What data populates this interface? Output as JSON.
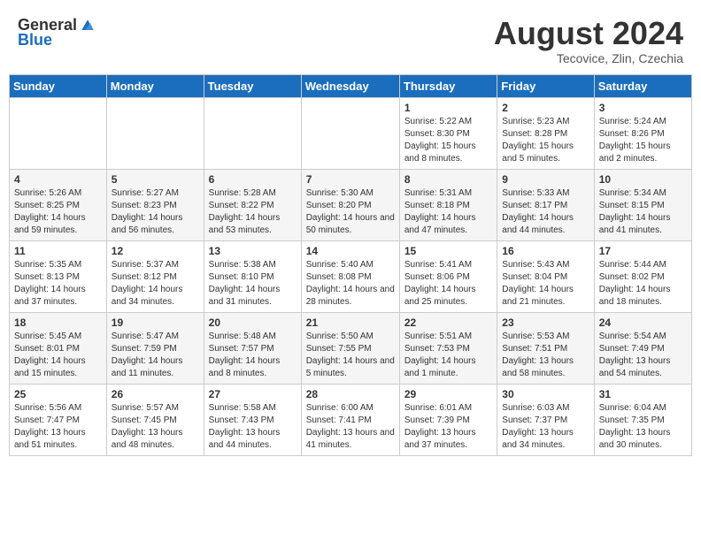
{
  "header": {
    "logo_general": "General",
    "logo_blue": "Blue",
    "month_title": "August 2024",
    "subtitle": "Tecovice, Zlin, Czechia"
  },
  "weekdays": [
    "Sunday",
    "Monday",
    "Tuesday",
    "Wednesday",
    "Thursday",
    "Friday",
    "Saturday"
  ],
  "weeks": [
    [
      {
        "day": "",
        "sunrise": "",
        "sunset": "",
        "daylight": ""
      },
      {
        "day": "",
        "sunrise": "",
        "sunset": "",
        "daylight": ""
      },
      {
        "day": "",
        "sunrise": "",
        "sunset": "",
        "daylight": ""
      },
      {
        "day": "",
        "sunrise": "",
        "sunset": "",
        "daylight": ""
      },
      {
        "day": "1",
        "sunrise": "Sunrise: 5:22 AM",
        "sunset": "Sunset: 8:30 PM",
        "daylight": "Daylight: 15 hours and 8 minutes."
      },
      {
        "day": "2",
        "sunrise": "Sunrise: 5:23 AM",
        "sunset": "Sunset: 8:28 PM",
        "daylight": "Daylight: 15 hours and 5 minutes."
      },
      {
        "day": "3",
        "sunrise": "Sunrise: 5:24 AM",
        "sunset": "Sunset: 8:26 PM",
        "daylight": "Daylight: 15 hours and 2 minutes."
      }
    ],
    [
      {
        "day": "4",
        "sunrise": "Sunrise: 5:26 AM",
        "sunset": "Sunset: 8:25 PM",
        "daylight": "Daylight: 14 hours and 59 minutes."
      },
      {
        "day": "5",
        "sunrise": "Sunrise: 5:27 AM",
        "sunset": "Sunset: 8:23 PM",
        "daylight": "Daylight: 14 hours and 56 minutes."
      },
      {
        "day": "6",
        "sunrise": "Sunrise: 5:28 AM",
        "sunset": "Sunset: 8:22 PM",
        "daylight": "Daylight: 14 hours and 53 minutes."
      },
      {
        "day": "7",
        "sunrise": "Sunrise: 5:30 AM",
        "sunset": "Sunset: 8:20 PM",
        "daylight": "Daylight: 14 hours and 50 minutes."
      },
      {
        "day": "8",
        "sunrise": "Sunrise: 5:31 AM",
        "sunset": "Sunset: 8:18 PM",
        "daylight": "Daylight: 14 hours and 47 minutes."
      },
      {
        "day": "9",
        "sunrise": "Sunrise: 5:33 AM",
        "sunset": "Sunset: 8:17 PM",
        "daylight": "Daylight: 14 hours and 44 minutes."
      },
      {
        "day": "10",
        "sunrise": "Sunrise: 5:34 AM",
        "sunset": "Sunset: 8:15 PM",
        "daylight": "Daylight: 14 hours and 41 minutes."
      }
    ],
    [
      {
        "day": "11",
        "sunrise": "Sunrise: 5:35 AM",
        "sunset": "Sunset: 8:13 PM",
        "daylight": "Daylight: 14 hours and 37 minutes."
      },
      {
        "day": "12",
        "sunrise": "Sunrise: 5:37 AM",
        "sunset": "Sunset: 8:12 PM",
        "daylight": "Daylight: 14 hours and 34 minutes."
      },
      {
        "day": "13",
        "sunrise": "Sunrise: 5:38 AM",
        "sunset": "Sunset: 8:10 PM",
        "daylight": "Daylight: 14 hours and 31 minutes."
      },
      {
        "day": "14",
        "sunrise": "Sunrise: 5:40 AM",
        "sunset": "Sunset: 8:08 PM",
        "daylight": "Daylight: 14 hours and 28 minutes."
      },
      {
        "day": "15",
        "sunrise": "Sunrise: 5:41 AM",
        "sunset": "Sunset: 8:06 PM",
        "daylight": "Daylight: 14 hours and 25 minutes."
      },
      {
        "day": "16",
        "sunrise": "Sunrise: 5:43 AM",
        "sunset": "Sunset: 8:04 PM",
        "daylight": "Daylight: 14 hours and 21 minutes."
      },
      {
        "day": "17",
        "sunrise": "Sunrise: 5:44 AM",
        "sunset": "Sunset: 8:02 PM",
        "daylight": "Daylight: 14 hours and 18 minutes."
      }
    ],
    [
      {
        "day": "18",
        "sunrise": "Sunrise: 5:45 AM",
        "sunset": "Sunset: 8:01 PM",
        "daylight": "Daylight: 14 hours and 15 minutes."
      },
      {
        "day": "19",
        "sunrise": "Sunrise: 5:47 AM",
        "sunset": "Sunset: 7:59 PM",
        "daylight": "Daylight: 14 hours and 11 minutes."
      },
      {
        "day": "20",
        "sunrise": "Sunrise: 5:48 AM",
        "sunset": "Sunset: 7:57 PM",
        "daylight": "Daylight: 14 hours and 8 minutes."
      },
      {
        "day": "21",
        "sunrise": "Sunrise: 5:50 AM",
        "sunset": "Sunset: 7:55 PM",
        "daylight": "Daylight: 14 hours and 5 minutes."
      },
      {
        "day": "22",
        "sunrise": "Sunrise: 5:51 AM",
        "sunset": "Sunset: 7:53 PM",
        "daylight": "Daylight: 14 hours and 1 minute."
      },
      {
        "day": "23",
        "sunrise": "Sunrise: 5:53 AM",
        "sunset": "Sunset: 7:51 PM",
        "daylight": "Daylight: 13 hours and 58 minutes."
      },
      {
        "day": "24",
        "sunrise": "Sunrise: 5:54 AM",
        "sunset": "Sunset: 7:49 PM",
        "daylight": "Daylight: 13 hours and 54 minutes."
      }
    ],
    [
      {
        "day": "25",
        "sunrise": "Sunrise: 5:56 AM",
        "sunset": "Sunset: 7:47 PM",
        "daylight": "Daylight: 13 hours and 51 minutes."
      },
      {
        "day": "26",
        "sunrise": "Sunrise: 5:57 AM",
        "sunset": "Sunset: 7:45 PM",
        "daylight": "Daylight: 13 hours and 48 minutes."
      },
      {
        "day": "27",
        "sunrise": "Sunrise: 5:58 AM",
        "sunset": "Sunset: 7:43 PM",
        "daylight": "Daylight: 13 hours and 44 minutes."
      },
      {
        "day": "28",
        "sunrise": "Sunrise: 6:00 AM",
        "sunset": "Sunset: 7:41 PM",
        "daylight": "Daylight: 13 hours and 41 minutes."
      },
      {
        "day": "29",
        "sunrise": "Sunrise: 6:01 AM",
        "sunset": "Sunset: 7:39 PM",
        "daylight": "Daylight: 13 hours and 37 minutes."
      },
      {
        "day": "30",
        "sunrise": "Sunrise: 6:03 AM",
        "sunset": "Sunset: 7:37 PM",
        "daylight": "Daylight: 13 hours and 34 minutes."
      },
      {
        "day": "31",
        "sunrise": "Sunrise: 6:04 AM",
        "sunset": "Sunset: 7:35 PM",
        "daylight": "Daylight: 13 hours and 30 minutes."
      }
    ]
  ]
}
